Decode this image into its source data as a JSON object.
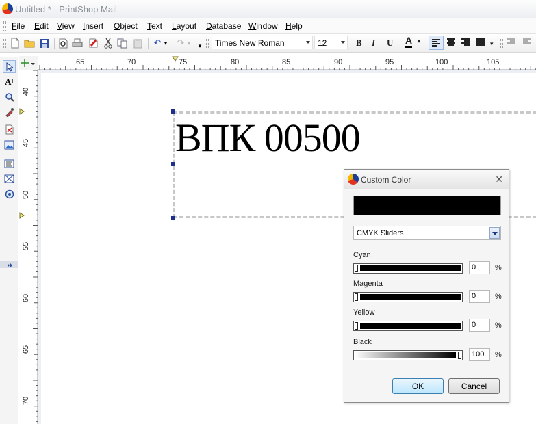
{
  "window": {
    "title": "Untitled * - PrintShop Mail"
  },
  "menu": [
    "File",
    "Edit",
    "View",
    "Insert",
    "Object",
    "Text",
    "Layout",
    "Database",
    "Window",
    "Help"
  ],
  "toolbar": {
    "font_name": "Times New Roman",
    "font_size": "12",
    "bold": "B",
    "italic": "I",
    "underline": "U",
    "text_color": "A"
  },
  "ruler": {
    "horizontal": [
      "65",
      "70",
      "75",
      "80",
      "85",
      "90",
      "95",
      "100",
      "105"
    ],
    "vertical": [
      "40",
      "45",
      "50",
      "55",
      "60",
      "65",
      "70"
    ]
  },
  "canvas": {
    "text": "ВПК 00500"
  },
  "dialog": {
    "title": "Custom Color",
    "preview_color": "#000000",
    "mode": "CMYK Sliders",
    "sliders": [
      {
        "label": "Cyan",
        "value": "0",
        "unit": "%"
      },
      {
        "label": "Magenta",
        "value": "0",
        "unit": "%"
      },
      {
        "label": "Yellow",
        "value": "0",
        "unit": "%"
      },
      {
        "label": "Black",
        "value": "100",
        "unit": "%"
      }
    ],
    "ok": "OK",
    "cancel": "Cancel"
  }
}
